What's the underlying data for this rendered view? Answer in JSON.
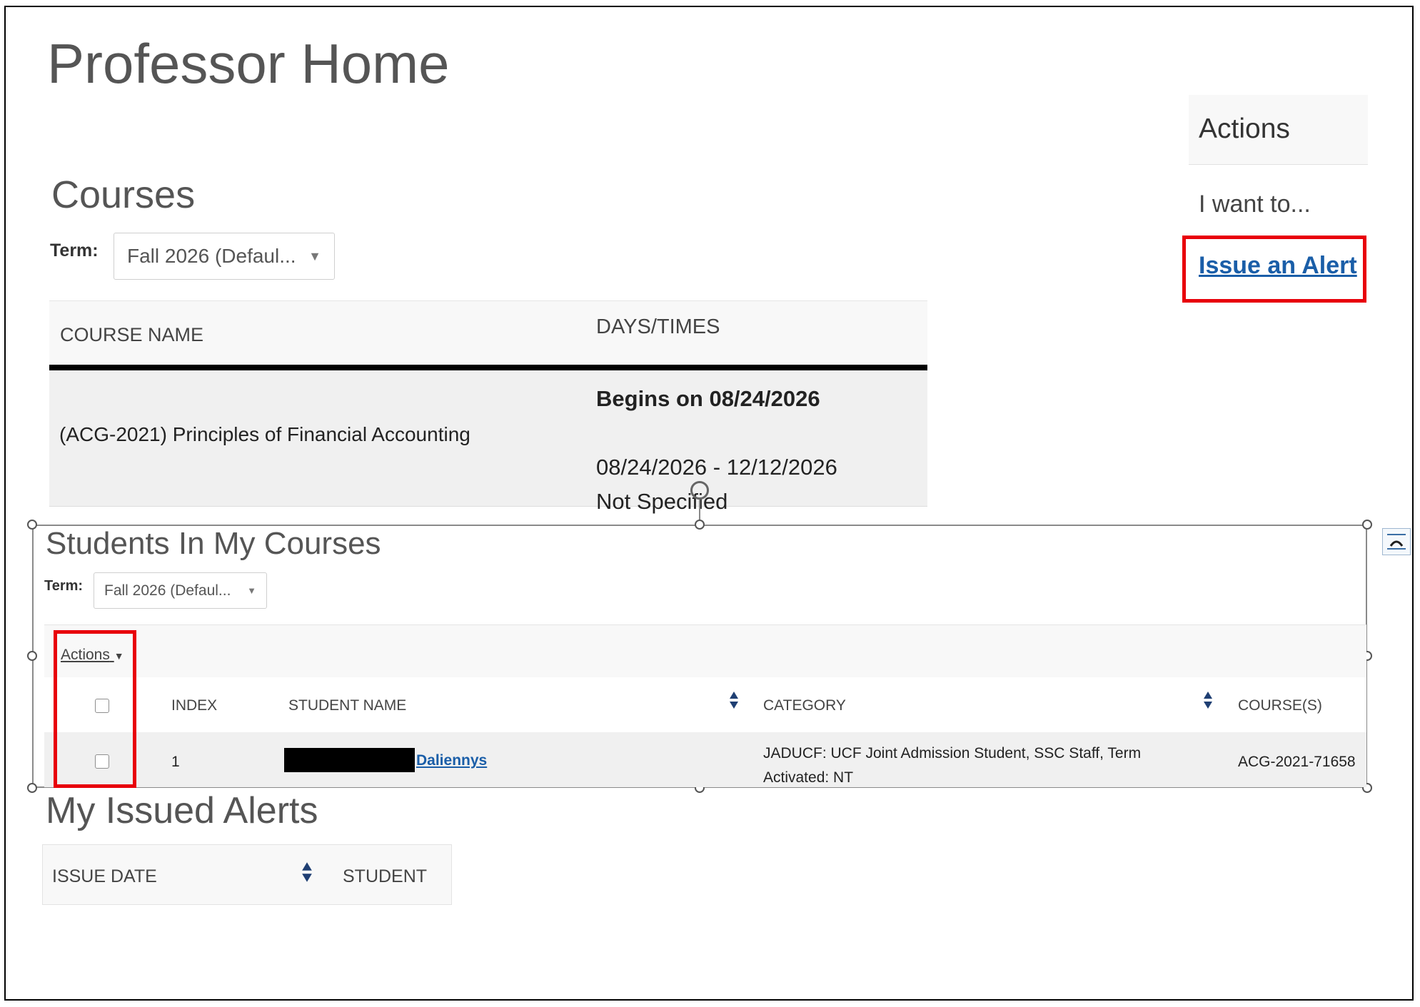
{
  "page": {
    "title": "Professor Home"
  },
  "courses": {
    "heading": "Courses",
    "term_label": "Term:",
    "term_value": "Fall 2026 (Defaul...",
    "columns": [
      "COURSE NAME",
      "DAYS/TIMES"
    ],
    "rows": [
      {
        "course_name": "(ACG-2021) Principles of Financial Accounting",
        "begins": "Begins on 08/24/2026",
        "date_range": "08/24/2026 - 12/12/2026",
        "schedule": "Not Specified"
      }
    ]
  },
  "actions_panel": {
    "heading": "Actions",
    "prompt": "I want to...",
    "issue_alert_link": "Issue an Alert"
  },
  "students": {
    "heading": "Students In My Courses",
    "term_label": "Term:",
    "term_value": "Fall 2026 (Defaul...",
    "actions_label": "Actions",
    "columns": [
      "INDEX",
      "STUDENT NAME",
      "CATEGORY",
      "COURSE(S)"
    ],
    "rows": [
      {
        "index": "1",
        "student_name": "Daliennys",
        "category_line1": "JADUCF: UCF Joint Admission Student, SSC Staff, Term",
        "category_line2": "Activated: NT",
        "courses": "ACG-2021-71658"
      }
    ]
  },
  "issued_alerts": {
    "heading": "My Issued Alerts",
    "columns": [
      "ISSUE DATE",
      "STUDENT"
    ]
  },
  "colors": {
    "link": "#1a5ea8",
    "highlight": "#e8000a",
    "heading": "#555555",
    "sort_icon": "#1f3f73"
  }
}
